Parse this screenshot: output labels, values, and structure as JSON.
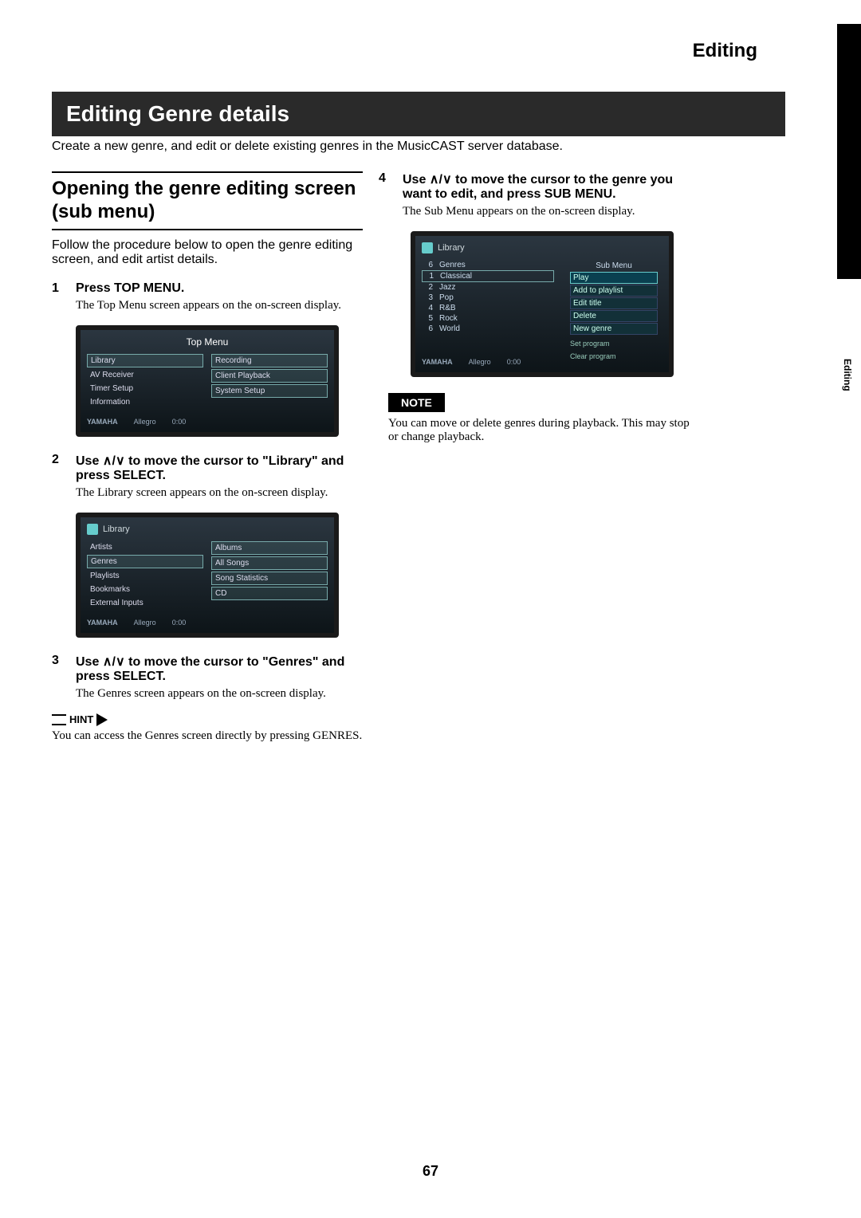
{
  "header": {
    "page_title": "Editing"
  },
  "side_label": "Editing",
  "title_bar": "Editing Genre details",
  "intro": "Create a new genre, and edit or delete existing genres in the MusicCAST server database.",
  "section": {
    "title": "Opening the genre editing screen (sub menu)",
    "desc": "Follow the procedure below to open the genre editing screen, and edit artist details."
  },
  "steps": {
    "s1": {
      "num": "1",
      "title": "Press TOP MENU.",
      "body": "The Top Menu screen appears on the on-screen display."
    },
    "s2": {
      "num": "2",
      "title_a": "Use ",
      "title_b": " to move the cursor to \"Library\" and press SELECT.",
      "body": "The Library screen appears on the on-screen display."
    },
    "s3": {
      "num": "3",
      "title_a": "Use ",
      "title_b": " to move the cursor to \"Genres\" and press SELECT.",
      "body": "The Genres screen appears on the on-screen display."
    },
    "s4": {
      "num": "4",
      "title_a": "Use ",
      "title_b": " to move the cursor to the genre you want to edit, and press SUB MENU.",
      "body": "The Sub Menu appears on the on-screen display."
    }
  },
  "hint": {
    "label": "HINT",
    "body": "You can access the Genres screen directly by pressing GENRES."
  },
  "note": {
    "label": "NOTE",
    "body": "You can move or delete genres during playback. This may stop or change playback."
  },
  "ui1": {
    "title": "Top Menu",
    "left": [
      "Library",
      "AV Receiver",
      "Timer Setup",
      "Information"
    ],
    "right": [
      "Recording",
      "Client Playback",
      "System Setup"
    ],
    "brand": "YAMAHA",
    "track": "Allegro",
    "time": "0:00"
  },
  "ui2": {
    "crumb": "Library",
    "left": [
      "Artists",
      "Genres",
      "Playlists",
      "Bookmarks",
      "External Inputs"
    ],
    "right": [
      "Albums",
      "All Songs",
      "Song Statistics",
      "CD"
    ],
    "brand": "YAMAHA",
    "track": "Allegro",
    "time": "0:00"
  },
  "ui3": {
    "crumb": "Library",
    "list_header": {
      "n": "6",
      "label": "Genres"
    },
    "list": [
      {
        "n": "1",
        "label": "Classical"
      },
      {
        "n": "2",
        "label": "Jazz"
      },
      {
        "n": "3",
        "label": "Pop"
      },
      {
        "n": "4",
        "label": "R&B"
      },
      {
        "n": "5",
        "label": "Rock"
      },
      {
        "n": "6",
        "label": "World"
      }
    ],
    "submenu": {
      "header": "Sub Menu",
      "opts": [
        "Play",
        "Add to playlist",
        "Edit title",
        "Delete",
        "New genre"
      ],
      "prog1": "Set program",
      "prog2": "Clear program"
    },
    "brand": "YAMAHA",
    "track": "Allegro",
    "time": "0:00"
  },
  "arrow_glyph": "∧/∨",
  "page_number": "67"
}
